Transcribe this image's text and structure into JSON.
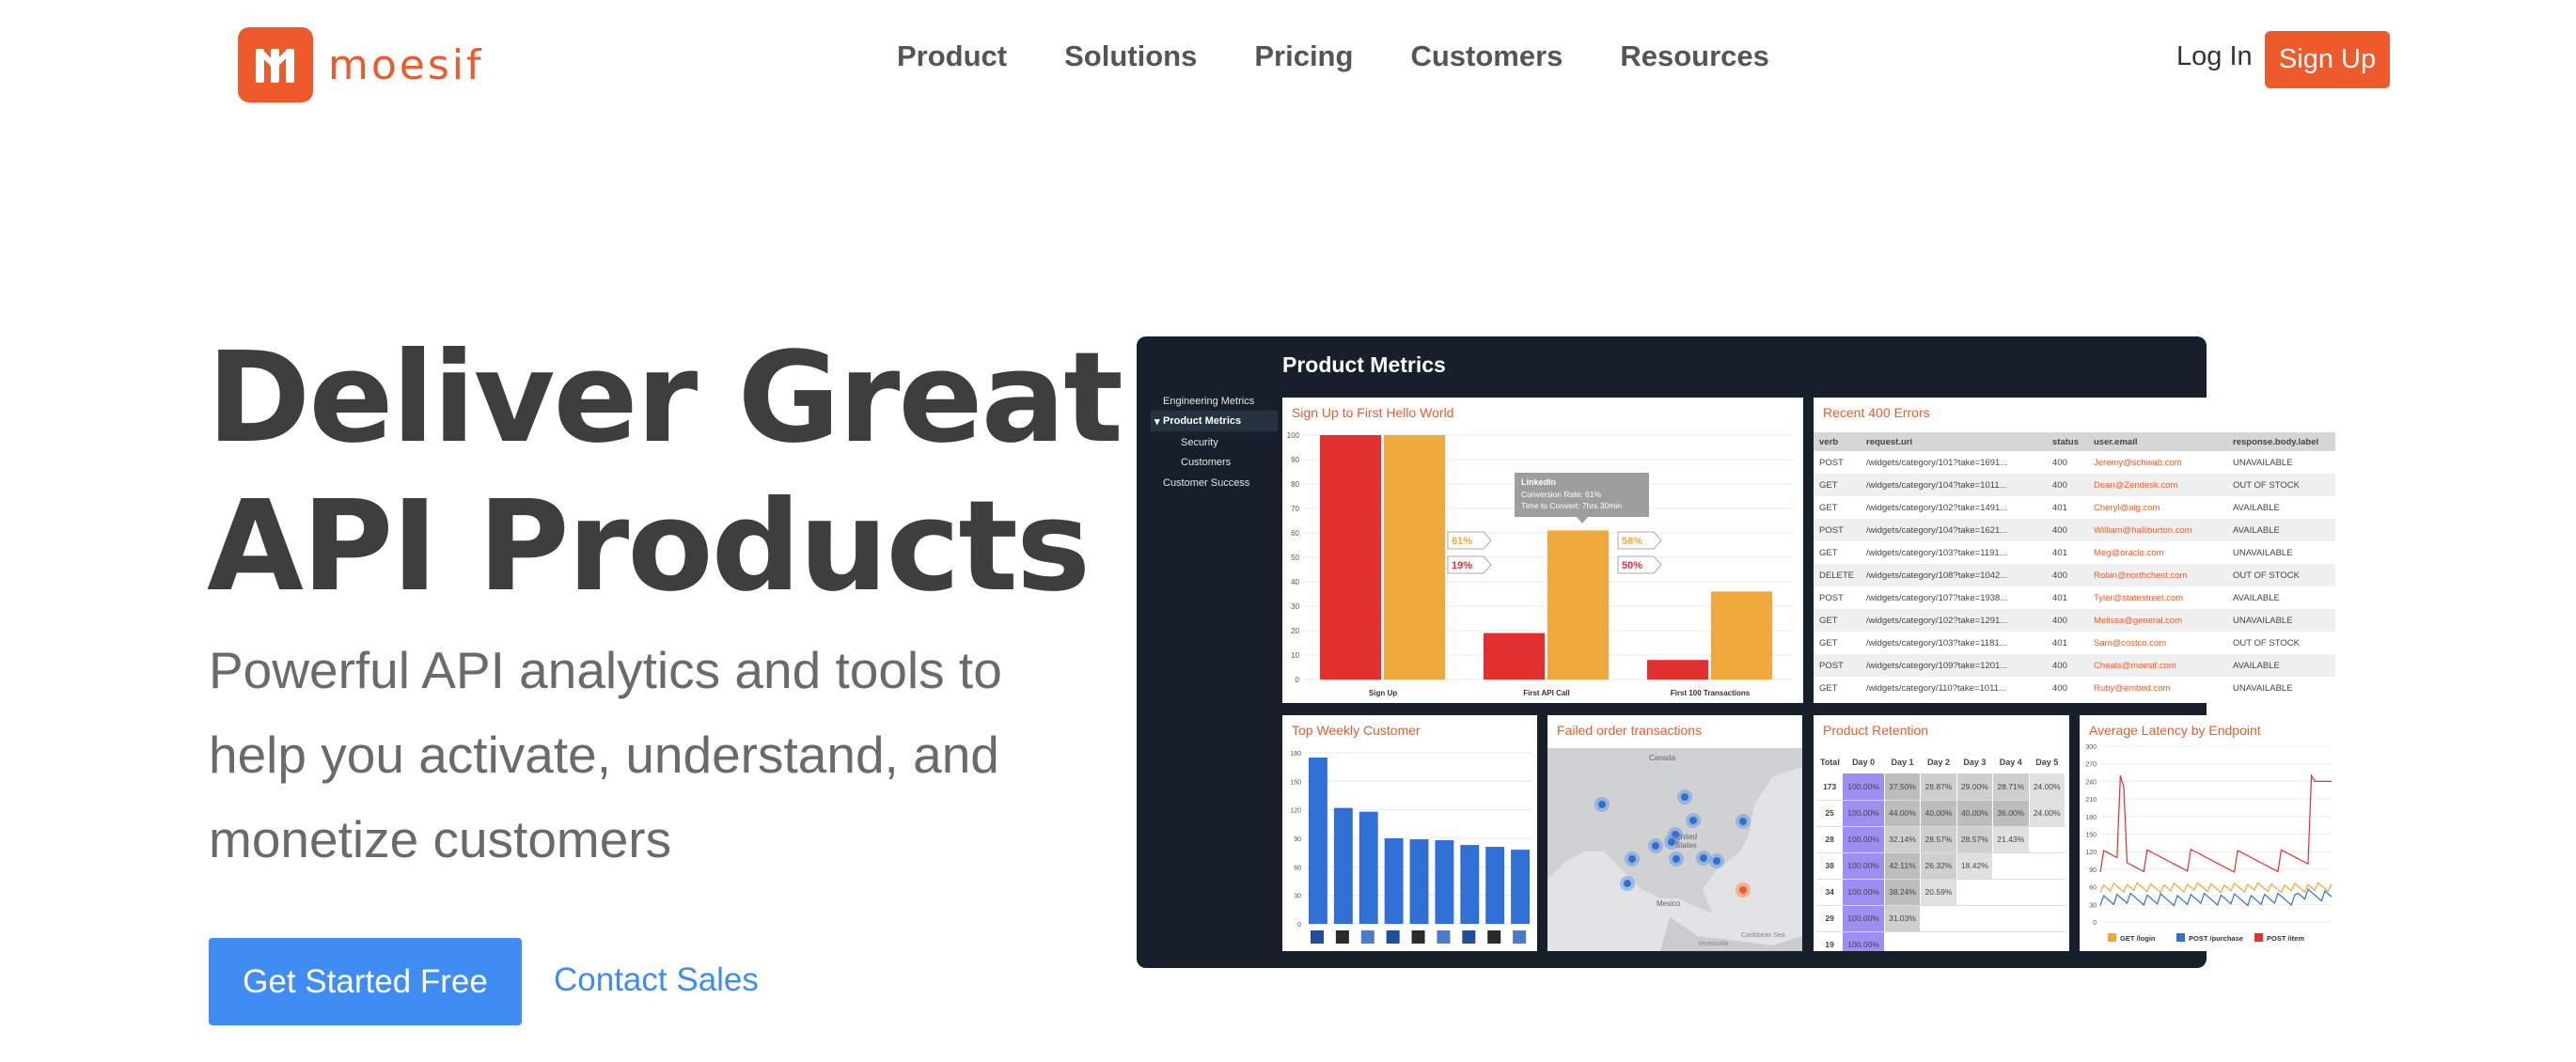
{
  "brand": {
    "name": "moesif",
    "accent": "#ee5a2b",
    "blue": "#3f8cf3"
  },
  "nav": {
    "items": [
      "Product",
      "Solutions",
      "Pricing",
      "Customers",
      "Resources"
    ],
    "login": "Log In",
    "signup": "Sign Up"
  },
  "hero": {
    "title_line1": "Deliver Great",
    "title_line2": "API Products",
    "subtitle": "Powerful API analytics and tools to help you activate, understand, and monetize customers",
    "cta_primary": "Get Started Free",
    "cta_secondary": "Contact Sales"
  },
  "dashboard": {
    "title": "Product Metrics",
    "sidebar": [
      "Engineering Metrics",
      "Product Metrics",
      "Security",
      "Customers",
      "Customer Success"
    ],
    "funnel": {
      "title": "Sign Up to First Hello World",
      "categories": [
        "Sign Up",
        "First API Call",
        "First 100 Transactions"
      ],
      "red": [
        100,
        19,
        8
      ],
      "orange": [
        100,
        61,
        36
      ],
      "yticks": [
        0,
        10,
        20,
        30,
        40,
        50,
        60,
        70,
        80,
        90,
        100
      ],
      "labels": [
        "61%",
        "19%",
        "58%",
        "50%"
      ],
      "tooltip": {
        "title": "LinkedIn",
        "rate": "Conversion Rate:   61%",
        "time": "Time to Convert:   7hrs 30min"
      }
    },
    "errors": {
      "title": "Recent 400 Errors",
      "columns": [
        "verb",
        "request.uri",
        "status",
        "user.email",
        "response.body.label"
      ],
      "rows": [
        [
          "POST",
          "/widgets/category/101?take=1691...",
          "400",
          "Jeremy@schwab.com",
          "UNAVAILABLE"
        ],
        [
          "GET",
          "/widgets/category/104?take=1011...",
          "400",
          "Dean@Zendesk.com",
          "OUT OF STOCK"
        ],
        [
          "GET",
          "/widgets/category/102?take=1491...",
          "401",
          "Cheryl@aig.com",
          "AVAILABLE"
        ],
        [
          "POST",
          "/widgets/category/104?take=1621...",
          "400",
          "William@halliburton.com",
          "AVAILABLE"
        ],
        [
          "GET",
          "/widgets/category/103?take=1191...",
          "401",
          "Meg@oracle.com",
          "UNAVAILABLE"
        ],
        [
          "DELETE",
          "/widgets/category/108?take=1042...",
          "400",
          "Robin@northchest.com",
          "OUT OF STOCK"
        ],
        [
          "POST",
          "/widgets/category/107?take=1938...",
          "401",
          "Tyler@statestreet.com",
          "AVAILABLE"
        ],
        [
          "GET",
          "/widgets/category/102?take=1291...",
          "400",
          "Melissa@general.com",
          "UNAVAILABLE"
        ],
        [
          "GET",
          "/widgets/category/103?take=1181...",
          "401",
          "Sam@costco.com",
          "OUT OF STOCK"
        ],
        [
          "POST",
          "/widgets/category/109?take=1201...",
          "400",
          "Cheals@moesif.com",
          "AVAILABLE"
        ],
        [
          "GET",
          "/widgets/category/110?take=1011...",
          "400",
          "Ruby@embed.com",
          "UNAVAILABLE"
        ]
      ]
    },
    "weekly": {
      "title": "Top Weekly Customer",
      "values": [
        175,
        122,
        118,
        90,
        89,
        88,
        83,
        81,
        78
      ],
      "yticks": [
        0,
        30,
        60,
        90,
        120,
        150,
        180
      ]
    },
    "map": {
      "title": "Failed order transactions",
      "labels": [
        "Canada",
        "United States",
        "Mexico",
        "Caribbean Sea",
        "Venezuela"
      ]
    },
    "retention": {
      "title": "Product Retention",
      "columns": [
        "Total",
        "Day 0",
        "Day 1",
        "Day 2",
        "Day 3",
        "Day 4",
        "Day 5"
      ],
      "rows": [
        [
          "173",
          "100.00%",
          "37.50%",
          "28.87%",
          "29.00%",
          "28.71%",
          "24.00%"
        ],
        [
          "25",
          "100.00%",
          "44.00%",
          "40.00%",
          "40.00%",
          "36.00%",
          "24.00%"
        ],
        [
          "28",
          "100.00%",
          "32.14%",
          "28.57%",
          "28.57%",
          "21.43%",
          ""
        ],
        [
          "38",
          "100.00%",
          "42.11%",
          "26.32%",
          "18.42%",
          "",
          ""
        ],
        [
          "34",
          "100.00%",
          "38.24%",
          "20.59%",
          "",
          "",
          ""
        ],
        [
          "29",
          "100.00%",
          "31.03%",
          "",
          "",
          "",
          ""
        ],
        [
          "19",
          "100.00%",
          "",
          "",
          "",
          "",
          ""
        ]
      ]
    },
    "latency": {
      "title": "Average Latency by Endpoint",
      "yticks": [
        0,
        30,
        60,
        90,
        120,
        150,
        180,
        210,
        240,
        270,
        300
      ],
      "legend": [
        "GET /login",
        "POST /purchase",
        "POST /item"
      ]
    }
  }
}
